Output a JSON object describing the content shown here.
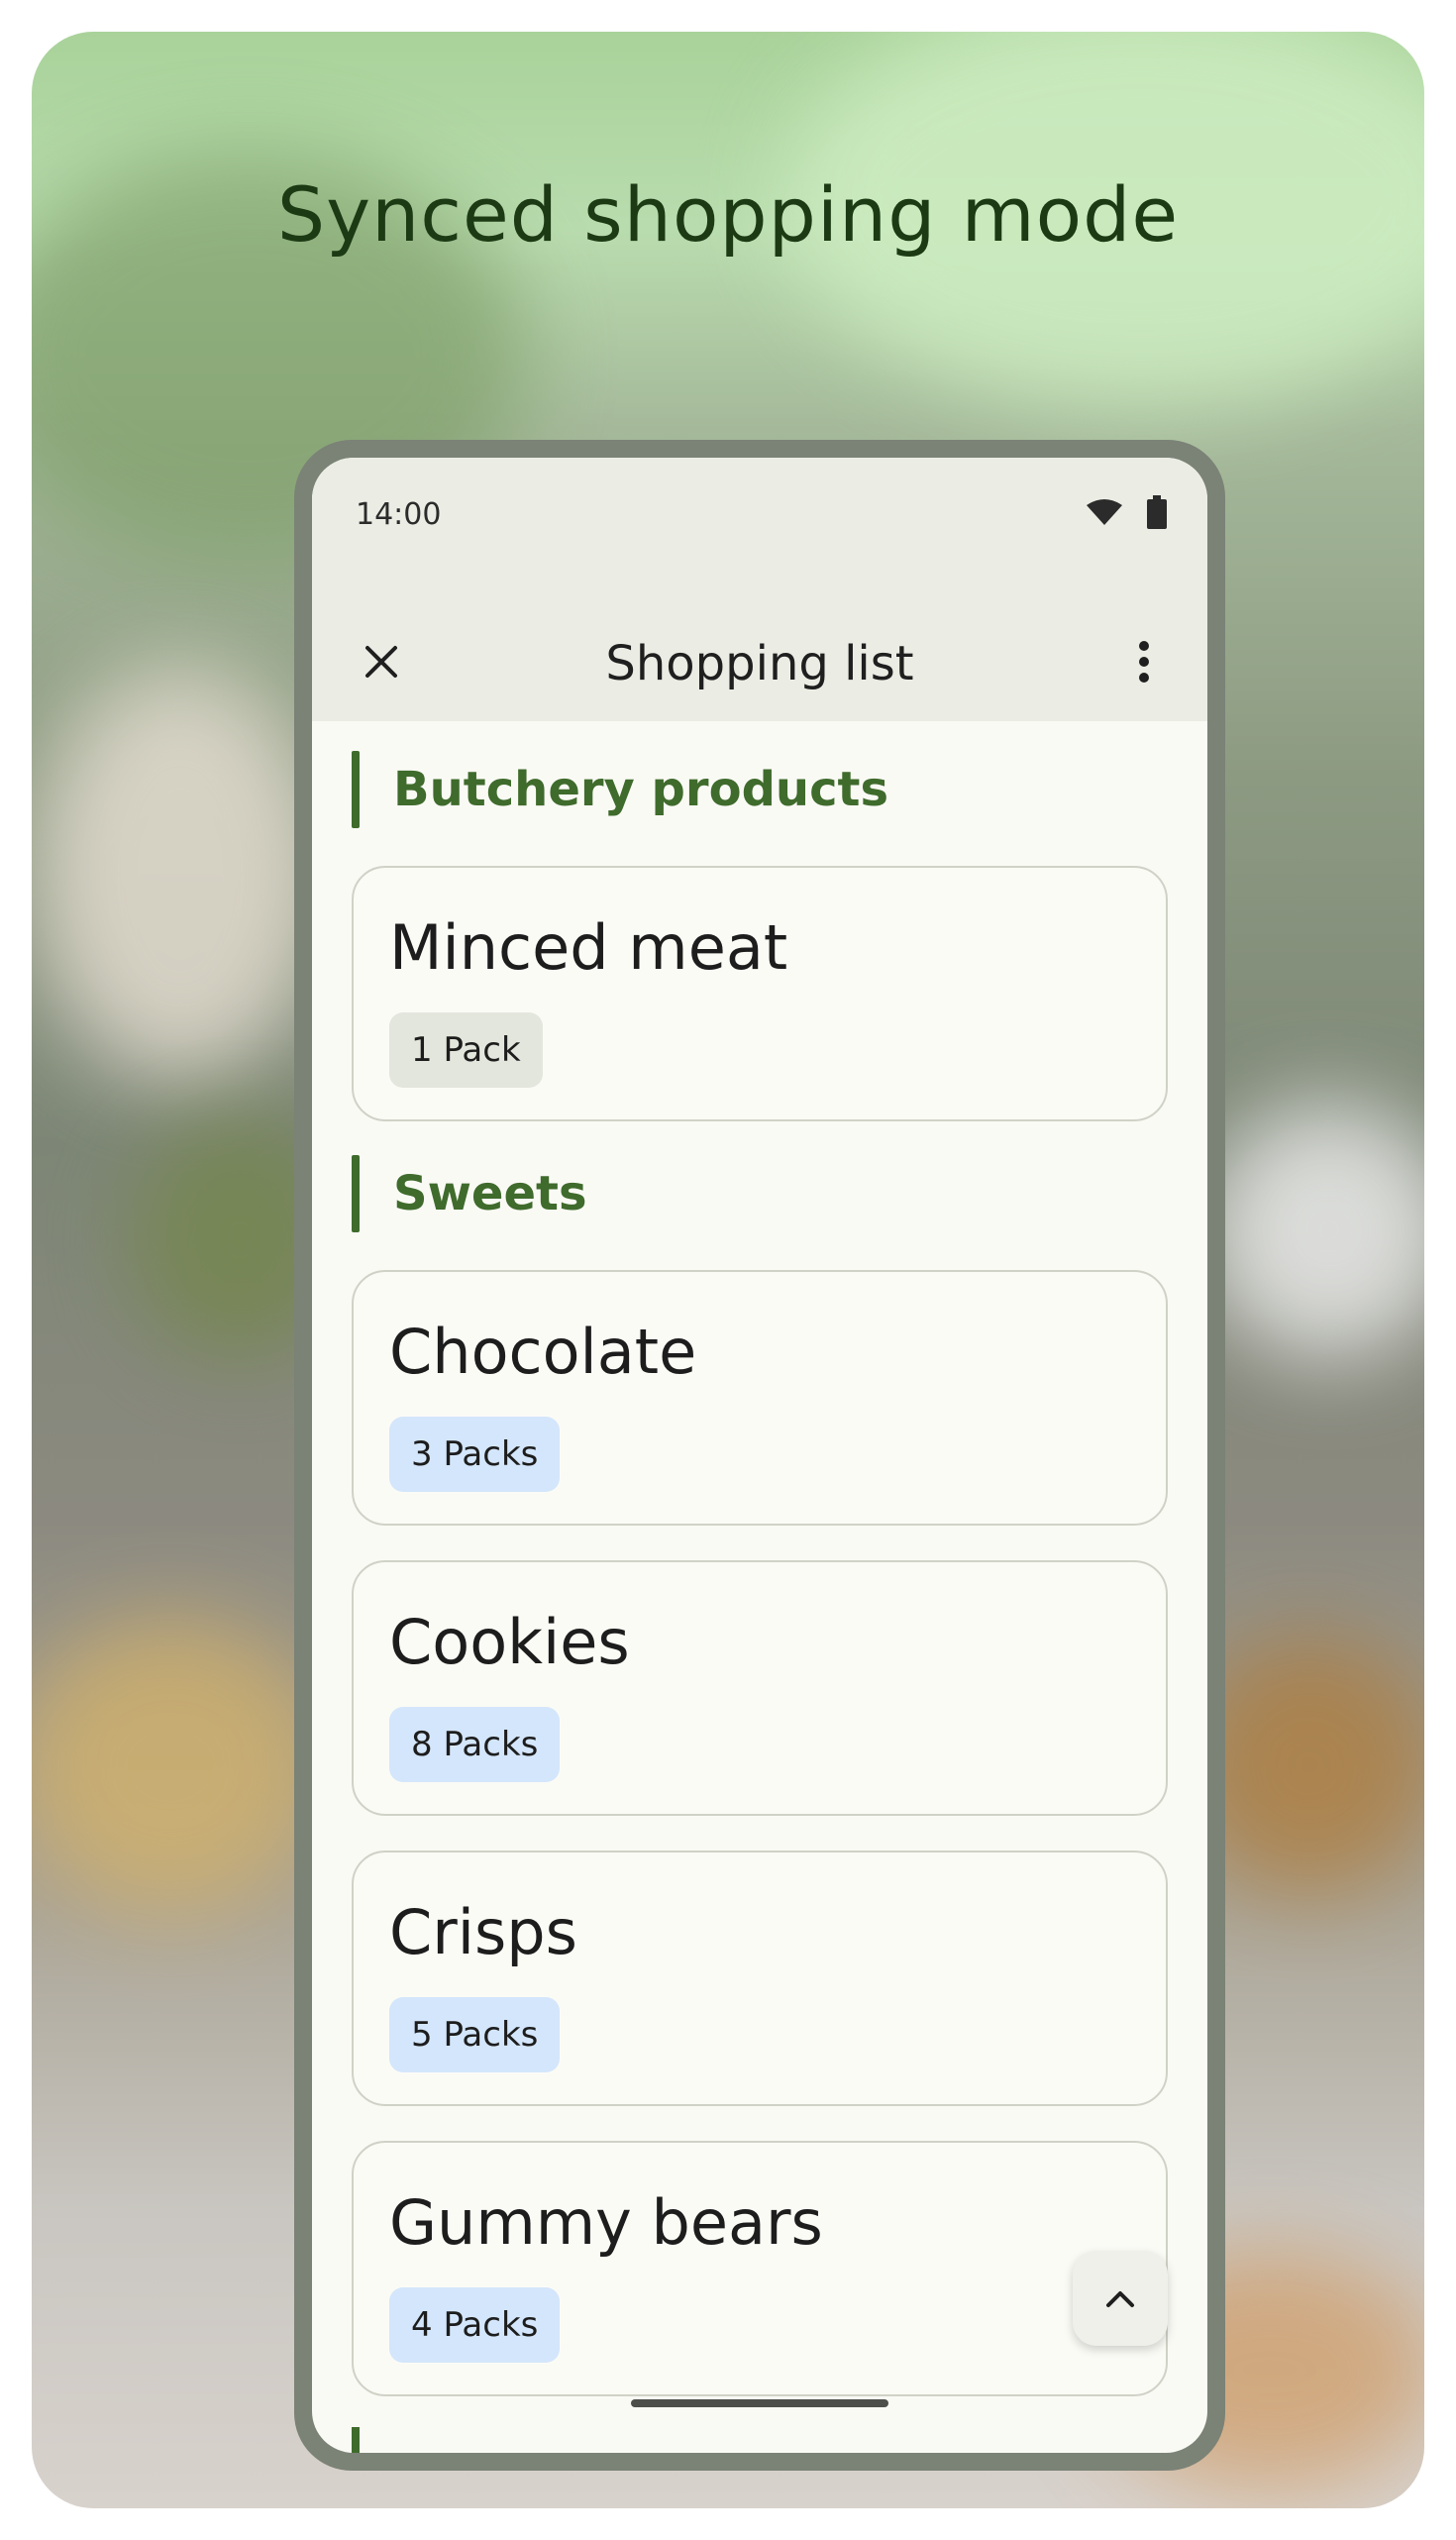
{
  "promo": {
    "title": "Synced shopping mode"
  },
  "status_bar": {
    "time": "14:00",
    "icons": [
      "wifi-icon",
      "battery-icon"
    ]
  },
  "app_bar": {
    "title": "Shopping list",
    "close_icon": "close-icon",
    "menu_icon": "more-vert-icon"
  },
  "sections": [
    {
      "label": "Butchery products",
      "items": [
        {
          "name": "Minced meat",
          "quantity": "1 Pack",
          "chip_color": "#e3e6dc"
        }
      ]
    },
    {
      "label": "Sweets",
      "items": [
        {
          "name": "Chocolate",
          "quantity": "3 Packs",
          "chip_color": "#d4e6fb"
        },
        {
          "name": "Cookies",
          "quantity": "8 Packs",
          "chip_color": "#d4e6fb"
        },
        {
          "name": "Crisps",
          "quantity": "5 Packs",
          "chip_color": "#d4e6fb"
        },
        {
          "name": "Gummy bears",
          "quantity": "4 Packs",
          "chip_color": "#d4e6fb"
        }
      ]
    }
  ],
  "scroll_top_button": {
    "icon": "chevron-up-icon"
  },
  "colors": {
    "accent": "#3f6b2c",
    "title_text": "#1c3a14",
    "phone_frame": "#7b8276",
    "screen_bg": "#fafaf5",
    "topbar_bg": "#ebede4"
  }
}
